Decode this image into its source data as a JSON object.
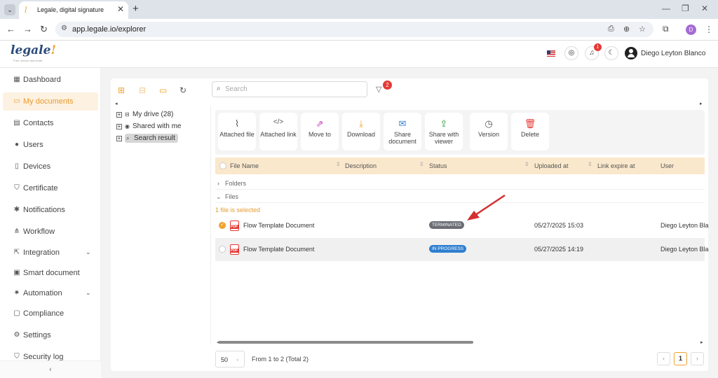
{
  "browser": {
    "tab_menu_icon": "chevron-down-icon",
    "tab_title": "Legale, digital signature",
    "tab_close": "✕",
    "new_tab": "+",
    "url": "app.legale.io/explorer",
    "profile_initial": "D"
  },
  "header": {
    "logo": "legale",
    "logo_tagline": "Free, secure and smart",
    "notification_count": "1",
    "user_name": "Diego Leyton Blanco"
  },
  "sidebar": {
    "items": [
      {
        "label": "Dashboard",
        "icon": "dashboard-icon"
      },
      {
        "label": "My documents",
        "icon": "folder-icon",
        "active": true
      },
      {
        "label": "Contacts",
        "icon": "contacts-icon"
      },
      {
        "label": "Users",
        "icon": "users-icon"
      },
      {
        "label": "Devices",
        "icon": "devices-icon"
      },
      {
        "label": "Certificate",
        "icon": "certificate-icon"
      },
      {
        "label": "Notifications",
        "icon": "notifications-icon"
      },
      {
        "label": "Workflow",
        "icon": "workflow-icon"
      },
      {
        "label": "Integration",
        "icon": "integration-icon",
        "expandable": true
      },
      {
        "label": "Smart document",
        "icon": "smart-document-icon"
      },
      {
        "label": "Automation",
        "icon": "automation-icon",
        "expandable": true
      },
      {
        "label": "Compliance",
        "icon": "compliance-icon"
      },
      {
        "label": "Settings",
        "icon": "settings-icon"
      },
      {
        "label": "Security log",
        "icon": "security-log-icon"
      }
    ],
    "collapse": "‹"
  },
  "search": {
    "placeholder": "Search"
  },
  "filter_count": "2",
  "tree": {
    "items": [
      {
        "label": "My drive (28)",
        "icon": "drive-icon"
      },
      {
        "label": "Shared with me",
        "icon": "shared-icon"
      },
      {
        "label": "Search result",
        "icon": "search-result-icon",
        "selected": true
      }
    ]
  },
  "actions": [
    {
      "label": "Attached file",
      "icon": "paperclip-icon",
      "color": "#555555"
    },
    {
      "label": "Attached link",
      "icon": "code-link-icon",
      "color": "#555555"
    },
    {
      "label": "Move to",
      "icon": "move-folder-icon",
      "color": "#c23fc0"
    },
    {
      "label": "Download",
      "icon": "download-icon",
      "color": "#f1a22c"
    },
    {
      "label": "Share document",
      "icon": "mail-icon",
      "color": "#2f7fd0"
    },
    {
      "label": "Share with viewer",
      "icon": "share-viewer-icon",
      "color": "#2e9a3e"
    },
    {
      "label": "Version",
      "icon": "version-icon",
      "color": "#555555"
    },
    {
      "label": "Delete",
      "icon": "trash-icon",
      "color": "#e53935"
    }
  ],
  "table": {
    "columns": [
      "File Name",
      "Description",
      "Status",
      "Uploaded at",
      "Link expire at",
      "User"
    ],
    "groups": {
      "folders": "Folders",
      "files": "Files"
    },
    "selection_info": "1 file is selected",
    "rows": [
      {
        "name": "Flow Template Document",
        "status": "TERMINATED",
        "uploaded": "05/27/2025 15:03",
        "user": "Diego Leyton Bla",
        "checked": true
      },
      {
        "name": "Flow Template Document",
        "status": "IN PROGRESS",
        "uploaded": "05/27/2025 14:19",
        "user": "Diego Leyton Bla",
        "checked": false
      }
    ]
  },
  "pagination": {
    "page_size": "50",
    "range": "From 1 to 2 (Total 2)",
    "current_page": "1",
    "prev": "‹",
    "next": "›"
  },
  "colors": {
    "accent": "#f1a22c",
    "status_terminated": "#6b6e76",
    "status_in_progress": "#2f7fd0",
    "annotation_arrow": "#d32f2f"
  }
}
